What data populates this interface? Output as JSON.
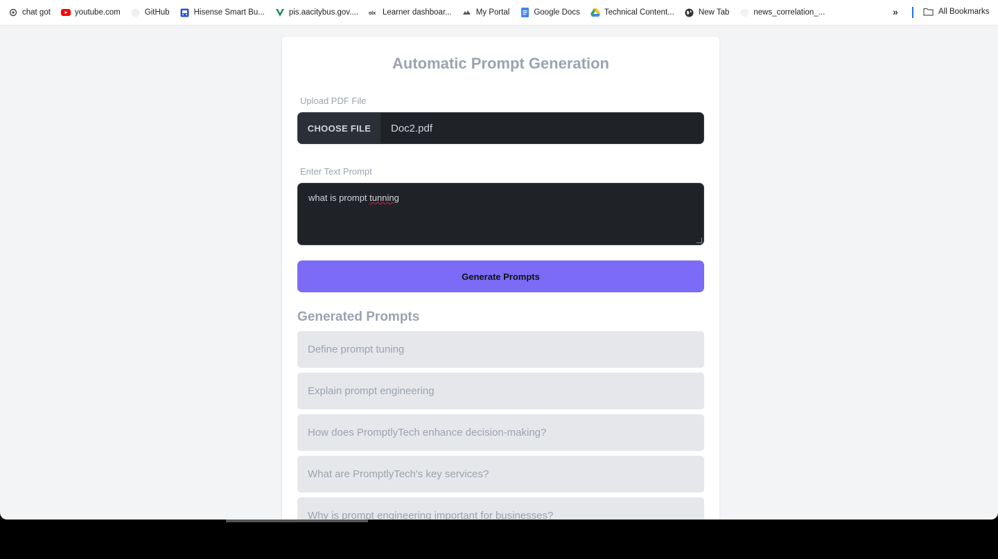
{
  "bookmarks": [
    {
      "label": "chat got",
      "icon": "openai-icon"
    },
    {
      "label": "youtube.com",
      "icon": "youtube-icon"
    },
    {
      "label": "GitHub",
      "icon": "github-icon"
    },
    {
      "label": "Hisense Smart Bu...",
      "icon": "bus-icon"
    },
    {
      "label": "pis.aacitybus.gov....",
      "icon": "v-logo-icon"
    },
    {
      "label": "Learner dashboar...",
      "icon": "olx-icon"
    },
    {
      "label": "My Portal",
      "icon": "portal-icon"
    },
    {
      "label": "Google Docs",
      "icon": "google-docs-icon"
    },
    {
      "label": "Technical Content...",
      "icon": "google-drive-icon"
    },
    {
      "label": "New Tab",
      "icon": "globe-icon"
    },
    {
      "label": "news_correlation_...",
      "icon": "blank-page-icon"
    }
  ],
  "bookmarks_all": "All Bookmarks",
  "page": {
    "title": "Automatic Prompt Generation",
    "upload_label": "Upload PDF File",
    "choose_file": "CHOOSE FILE",
    "file_name": "Doc2.pdf",
    "prompt_label": "Enter Text Prompt",
    "prompt_value_start": "what is prompt ",
    "prompt_value_misspelled": "tunning",
    "generate_button": "Generate Prompts",
    "generated_title": "Generated Prompts",
    "generated": [
      "Define prompt tuning",
      "Explain prompt engineering",
      "How does PromptlyTech enhance decision-making?",
      "What are PromptlyTech's key services?",
      "Why is prompt engineering important for businesses?"
    ]
  },
  "colors": {
    "accent": "#7c6bf6",
    "input_bg": "#1f2328",
    "muted_text": "#9ca3af",
    "item_bg": "#e5e7eb"
  }
}
